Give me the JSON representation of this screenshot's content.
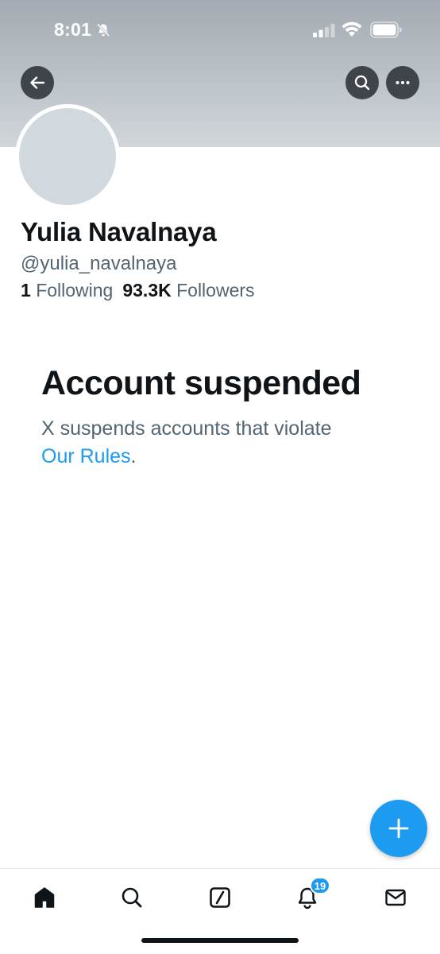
{
  "status_bar": {
    "time": "8:01",
    "icons": [
      "bell-slash-icon",
      "cellular-signal-icon",
      "wifi-icon",
      "battery-icon"
    ]
  },
  "header": {
    "icons": [
      "back-arrow-icon",
      "search-icon",
      "more-icon"
    ],
    "banner_color": "#b8bfc5"
  },
  "profile": {
    "avatar_color": "#d1d9de",
    "display_name": "Yulia Navalnaya",
    "handle": "@yulia_navalnaya",
    "following_count": "1",
    "following_label": "Following",
    "followers_count": "93.3K",
    "followers_label": "Followers"
  },
  "suspension": {
    "title": "Account suspended",
    "message": "X suspends accounts that violate",
    "link_text": "Our Rules",
    "trailing": "."
  },
  "fab": {
    "icon": "plus-icon"
  },
  "bottom_nav": {
    "items": [
      {
        "icon": "home-icon"
      },
      {
        "icon": "search-icon"
      },
      {
        "icon": "grok-icon"
      },
      {
        "icon": "notifications-bell-icon"
      },
      {
        "icon": "messages-envelope-icon"
      }
    ],
    "notification_badge": "19"
  },
  "colors": {
    "accent": "#1d9bf0",
    "text_primary": "#0f1419",
    "text_secondary": "#536471"
  }
}
